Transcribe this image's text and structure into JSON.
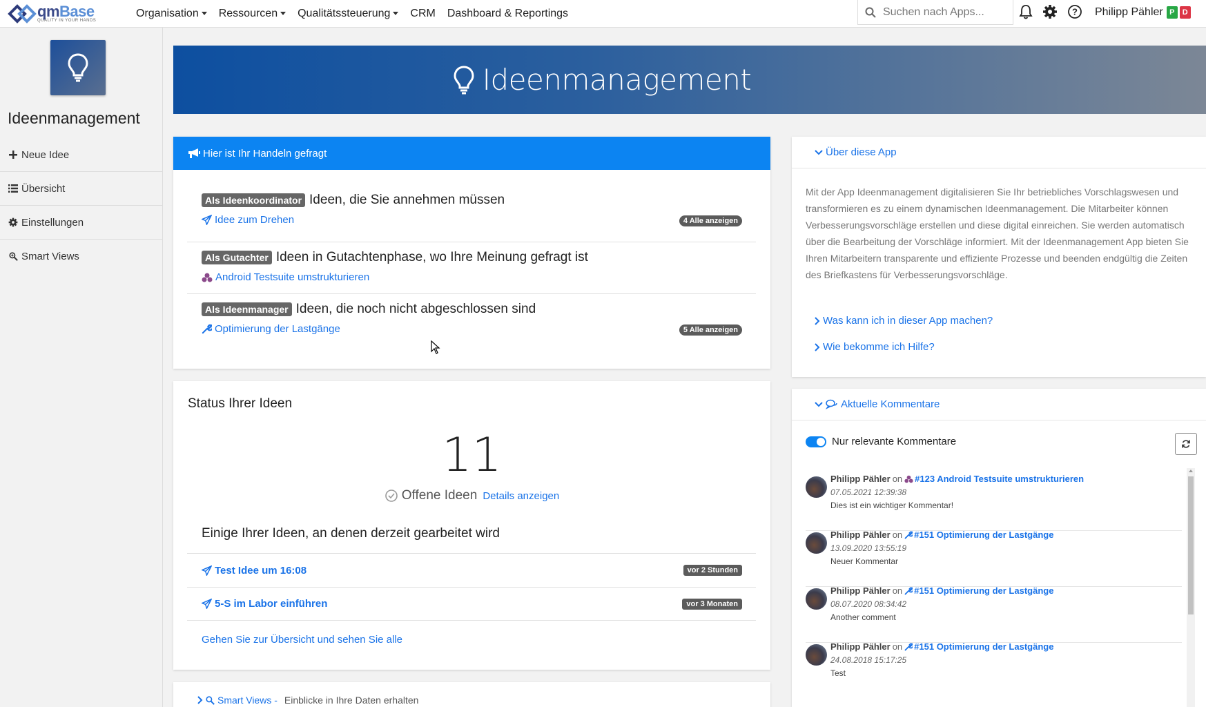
{
  "brand": {
    "name_part1": "qm",
    "name_part2": "Base",
    "tagline": "QUALITY IN YOUR HANDS"
  },
  "nav": [
    {
      "label": "Organisation",
      "dropdown": true
    },
    {
      "label": "Ressourcen",
      "dropdown": true
    },
    {
      "label": "Qualitätssteuerung",
      "dropdown": true
    },
    {
      "label": "CRM",
      "dropdown": false
    },
    {
      "label": "Dashboard & Reportings",
      "dropdown": false
    }
  ],
  "search": {
    "placeholder": "Suchen nach Apps..."
  },
  "user": {
    "name": "Philipp Pähler",
    "badge_p": "P",
    "badge_d": "D",
    "badge_p_color": "#28a745",
    "badge_d_color": "#dc3545"
  },
  "sidebar": {
    "title": "Ideenmanagement",
    "items": [
      {
        "label": "Neue Idee",
        "icon": "plus-icon"
      },
      {
        "label": "Übersicht",
        "icon": "list-icon"
      },
      {
        "label": "Einstellungen",
        "icon": "gear-icon"
      },
      {
        "label": "Smart Views",
        "icon": "zoom-icon"
      }
    ]
  },
  "banner": {
    "title": "Ideenmanagement"
  },
  "action": {
    "header": "Hier ist Ihr Handeln gefragt",
    "tasks": [
      {
        "role": "Als Ideenkoordinator",
        "title": "Ideen, die Sie annehmen müssen",
        "link": "Idee zum Drehen",
        "icon": "paper-plane-icon",
        "count": "4",
        "count_label": "Alle anzeigen"
      },
      {
        "role": "Als Gutachter",
        "title": "Ideen in Gutachtenphase, wo Ihre Meinung gefragt ist",
        "link": "Android Testsuite umstrukturieren",
        "icon": "cubes-icon"
      },
      {
        "role": "Als Ideenmanager",
        "title": "Ideen, die noch nicht abgeschlossen sind",
        "link": "Optimierung der Lastgänge",
        "icon": "wrench-icon",
        "count": "5",
        "count_label": "Alle anzeigen"
      }
    ]
  },
  "status": {
    "title": "Status Ihrer Ideen",
    "open_count": "11",
    "open_label": "Offene Ideen",
    "details_link": "Details anzeigen",
    "in_progress_title": "Einige Ihrer Ideen, an denen derzeit gearbeitet wird",
    "ideas": [
      {
        "title": "Test Idee um 16:08",
        "time": "vor 2 Stunden"
      },
      {
        "title": "5-S im Labor einführen",
        "time": "vor 3 Monaten"
      }
    ],
    "all_link": "Gehen Sie zur Übersicht und sehen Sie alle"
  },
  "smart_views": {
    "label": "Smart Views -",
    "desc": "Einblicke in Ihre Daten erhalten"
  },
  "about": {
    "header": "Über diese App",
    "text": "Mit der App Ideenmanagement digitalisieren Sie Ihr betriebliches Vorschlagswesen und transformieren es zu einem dynamischen Ideenmanagement. Die Mitarbeiter können Verbesserungsvorschläge erstellen und diese digital einreichen. Sie werden automatisch über die Bearbeitung der Vorschläge informiert. Mit der Ideenmanagement App bieten Sie Ihren Mitarbeitern transparente und effiziente Prozesse und beenden endgültig die Zeiten des Briefkastens für Verbesserungsvorschläge.",
    "faq1": "Was kann ich in dieser App machen?",
    "faq2": "Wie bekomme ich Hilfe?"
  },
  "comments": {
    "header": "Aktuelle Kommentare",
    "toggle_label": "Nur relevante Kommentare",
    "items": [
      {
        "author": "Philipp Pähler",
        "on": "on",
        "ref": "#123 Android Testsuite umstrukturieren",
        "icon": "cubes-icon",
        "date": "07.05.2021 12:39:38",
        "text": "Dies ist ein wichtiger Kommentar!"
      },
      {
        "author": "Philipp Pähler",
        "on": "on",
        "ref": "#151 Optimierung der Lastgänge",
        "icon": "wrench-icon",
        "date": "13.09.2020 13:55:19",
        "text": "Neuer Kommentar"
      },
      {
        "author": "Philipp Pähler",
        "on": "on",
        "ref": "#151 Optimierung der Lastgänge",
        "icon": "wrench-icon",
        "date": "08.07.2020 08:34:42",
        "text": "Another comment"
      },
      {
        "author": "Philipp Pähler",
        "on": "on",
        "ref": "#151 Optimierung der Lastgänge",
        "icon": "wrench-icon",
        "date": "24.08.2018 15:17:25",
        "text": "Test"
      }
    ]
  },
  "colors": {
    "primary": "#0c84f2",
    "link": "#1a73e8",
    "badge": "#5b5b5b"
  }
}
